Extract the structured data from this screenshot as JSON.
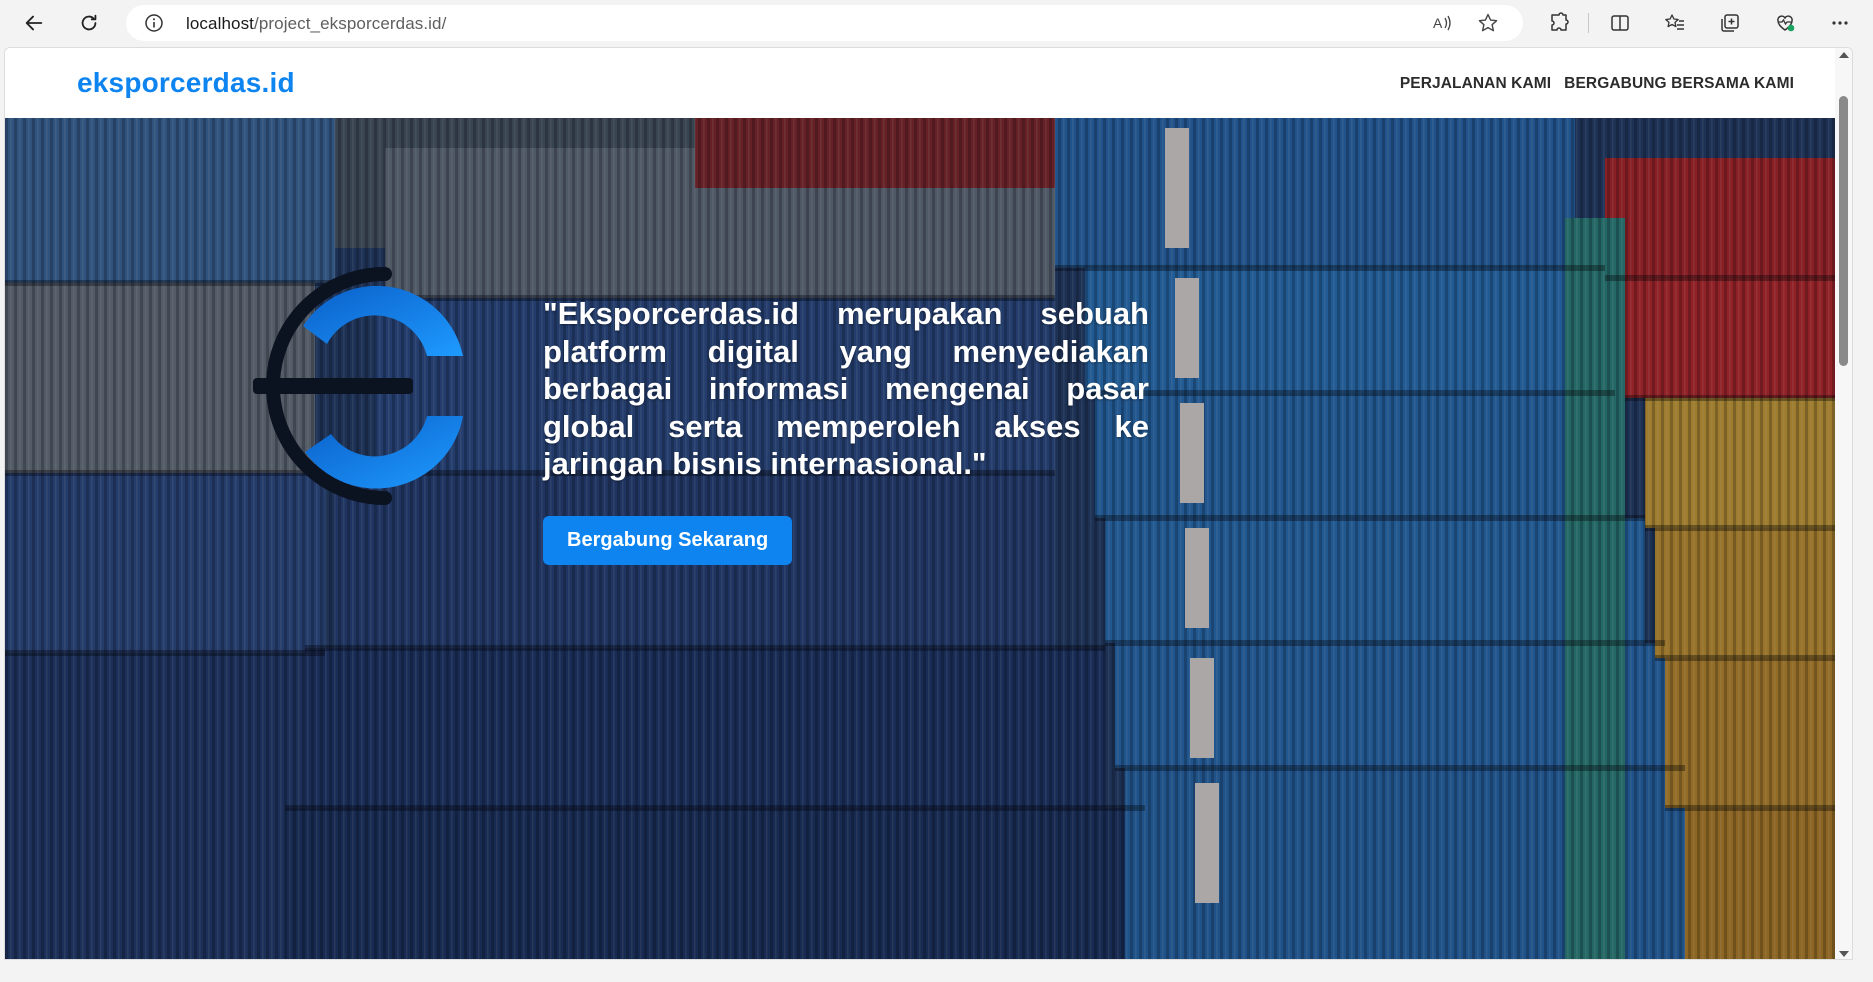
{
  "browser": {
    "url_host": "localhost",
    "url_path": "/project_eksporcerdas.id/",
    "icons": {
      "back": "arrow-left-icon",
      "reload": "reload-icon",
      "info": "info-icon",
      "read_aloud": "read-aloud-icon",
      "favorite": "star-icon",
      "extensions": "puzzle-icon",
      "split_screen": "split-screen-icon",
      "favorites": "favorites-list-icon",
      "collections": "collections-icon",
      "browser_essentials": "heart-pulse-icon",
      "more": "more-dots-icon"
    }
  },
  "header": {
    "brand": "eksporcerdas.id",
    "nav": [
      {
        "label": "PERJALANAN KAMI"
      },
      {
        "label": "BERGABUNG BERSAMA KAMI"
      }
    ]
  },
  "hero": {
    "quote": "\"Eksporcerdas.id merupakan sebuah platform digital yang menyediakan berbagai informasi mengenai pasar global serta memperoleh akses ke jaringan bisnis internasional.\"",
    "cta_label": "Bergabung Sekarang",
    "logo_icon": "eksporcerdas-logo-icon"
  },
  "colors": {
    "brand": "#0d84ef",
    "nav_text": "#2c2c2c",
    "hero_text": "#ffffff"
  }
}
